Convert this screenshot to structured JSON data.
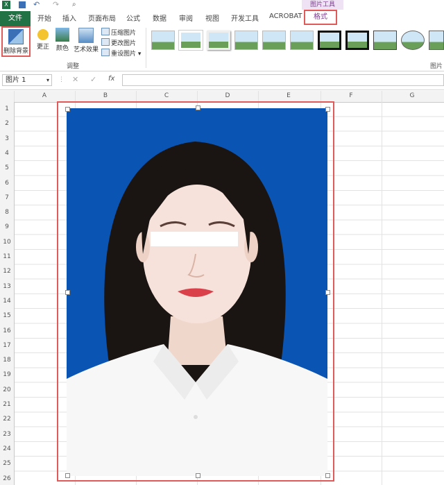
{
  "tabs": {
    "file": "文件",
    "items": [
      "开始",
      "插入",
      "页面布局",
      "公式",
      "数据",
      "审阅",
      "视图",
      "开发工具",
      "ACROBAT"
    ],
    "context_label": "图片工具",
    "format": "格式"
  },
  "ribbon": {
    "remove_bg": "删除背景",
    "correct": "更正",
    "color": "颜色",
    "artistic": "艺术效果",
    "compress": "压缩图片",
    "change": "更改图片",
    "reset": "重设图片",
    "group_adjust": "调整",
    "group_pic": "图片"
  },
  "formula_bar": {
    "name_box": "图片 1",
    "fx": "fx"
  },
  "columns": [
    "A",
    "B",
    "C",
    "D",
    "E",
    "F",
    "G"
  ],
  "rows": [
    "1",
    "2",
    "3",
    "4",
    "5",
    "6",
    "7",
    "8",
    "9",
    "10",
    "11",
    "12",
    "13",
    "14",
    "15",
    "16",
    "17",
    "18",
    "19",
    "20",
    "21",
    "22",
    "23",
    "24",
    "25",
    "26"
  ],
  "colors": {
    "excel_green": "#217346",
    "photo_bg": "#0a55b4",
    "highlight": "#e05a5a",
    "context_purple": "#7b3e8f"
  }
}
